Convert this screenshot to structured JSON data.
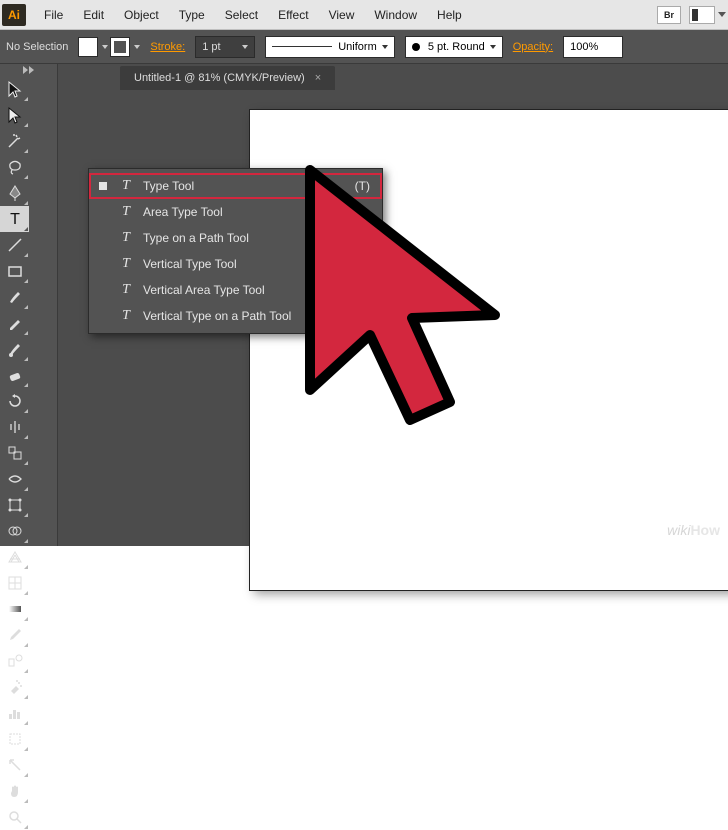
{
  "menu": {
    "logo": "Ai",
    "items": [
      "File",
      "Edit",
      "Object",
      "Type",
      "Select",
      "Effect",
      "View",
      "Window",
      "Help"
    ],
    "bridge_badge": "Br"
  },
  "options": {
    "selection_label": "No Selection",
    "stroke_label": "Stroke:",
    "stroke_value": "1 pt",
    "profile_label": "Uniform",
    "brush_label": "5 pt. Round",
    "opacity_label": "Opacity:",
    "opacity_value": "100%"
  },
  "document": {
    "tab_title": "Untitled-1 @ 81% (CMYK/Preview)"
  },
  "tools": [
    {
      "name": "selection-tool",
      "active": false
    },
    {
      "name": "direct-selection-tool",
      "active": false
    },
    {
      "name": "magic-wand-tool",
      "active": false
    },
    {
      "name": "lasso-tool",
      "active": false
    },
    {
      "name": "pen-tool",
      "active": false
    },
    {
      "name": "type-tool",
      "active": true
    },
    {
      "name": "line-segment-tool",
      "active": false
    },
    {
      "name": "rectangle-tool",
      "active": false
    },
    {
      "name": "paintbrush-tool",
      "active": false
    },
    {
      "name": "pencil-tool",
      "active": false
    },
    {
      "name": "blob-brush-tool",
      "active": false
    },
    {
      "name": "eraser-tool",
      "active": false
    },
    {
      "name": "rotate-tool",
      "active": false
    },
    {
      "name": "reflect-tool",
      "active": false
    },
    {
      "name": "scale-tool",
      "active": false
    },
    {
      "name": "width-tool",
      "active": false
    },
    {
      "name": "free-transform-tool",
      "active": false
    },
    {
      "name": "shape-builder-tool",
      "active": false
    },
    {
      "name": "perspective-grid-tool",
      "active": false
    },
    {
      "name": "mesh-tool",
      "active": false
    },
    {
      "name": "gradient-tool",
      "active": false
    },
    {
      "name": "eyedropper-tool",
      "active": false
    },
    {
      "name": "blend-tool",
      "active": false
    },
    {
      "name": "symbol-sprayer-tool",
      "active": false
    },
    {
      "name": "column-graph-tool",
      "active": false
    },
    {
      "name": "artboard-tool",
      "active": false
    },
    {
      "name": "slice-tool",
      "active": false
    },
    {
      "name": "hand-tool",
      "active": false
    },
    {
      "name": "zoom-tool",
      "active": false
    }
  ],
  "type_flyout": {
    "items": [
      {
        "label": "Type Tool",
        "shortcut": "(T)",
        "selected": true,
        "icon": "T"
      },
      {
        "label": "Area Type Tool",
        "shortcut": "",
        "selected": false,
        "icon": "T"
      },
      {
        "label": "Type on a Path Tool",
        "shortcut": "",
        "selected": false,
        "icon": "T"
      },
      {
        "label": "Vertical Type Tool",
        "shortcut": "",
        "selected": false,
        "icon": "T"
      },
      {
        "label": "Vertical Area Type Tool",
        "shortcut": "",
        "selected": false,
        "icon": "T"
      },
      {
        "label": "Vertical Type on a Path Tool",
        "shortcut": "",
        "selected": false,
        "icon": "T"
      }
    ]
  },
  "watermark": {
    "text_plain": "wiki",
    "text_bold": "How"
  }
}
